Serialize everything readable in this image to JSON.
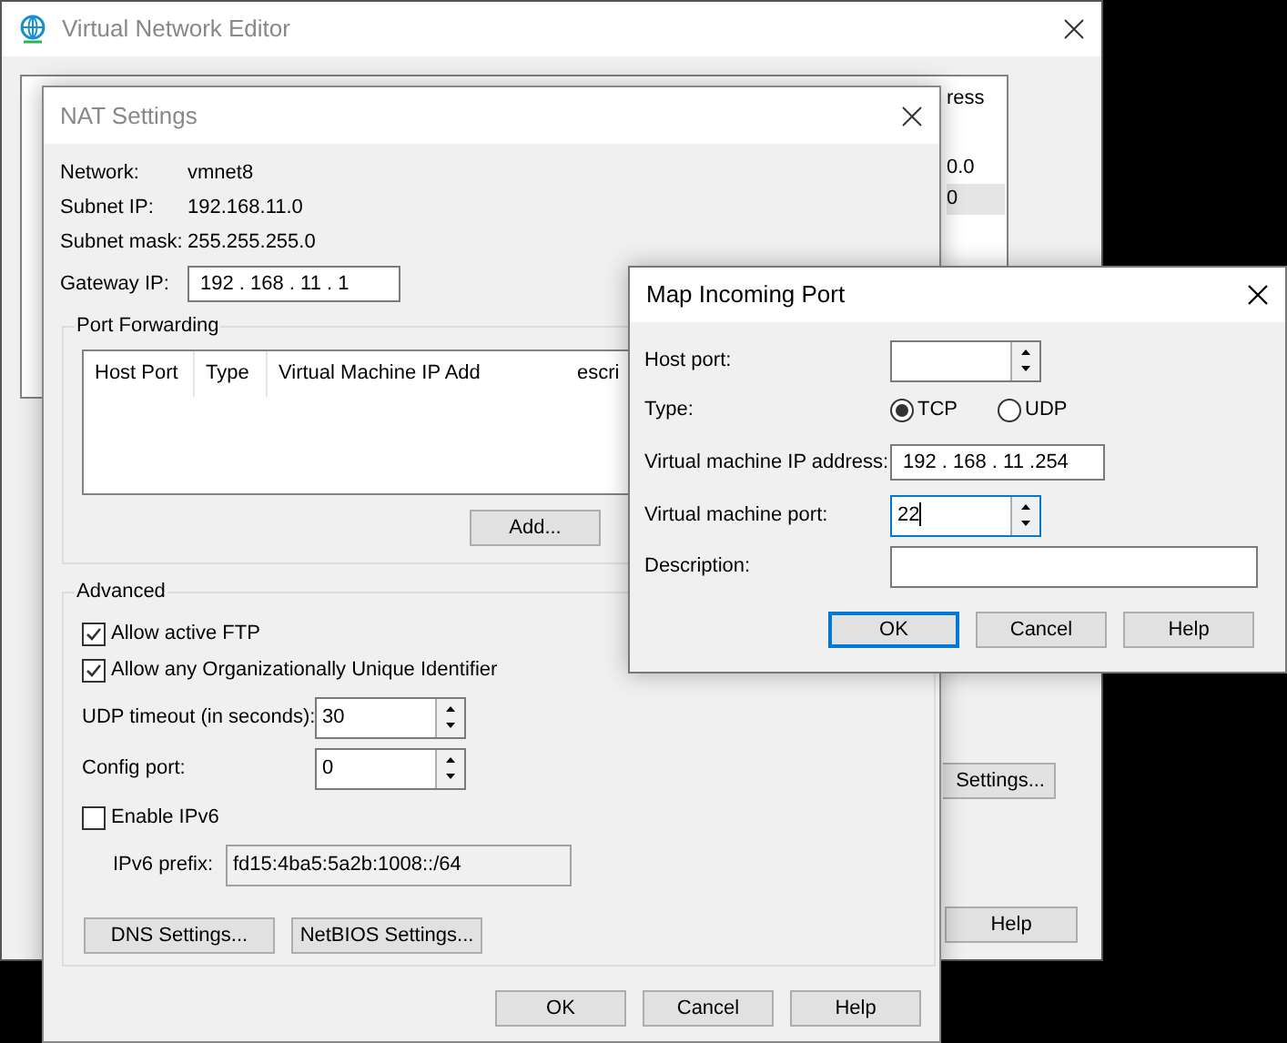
{
  "editor_window": {
    "title": "Virtual Network Editor",
    "table": {
      "header_fragment": "ress",
      "rows": [
        {
          "selected": false
        },
        {
          "column_5": "0.0",
          "selected": false
        },
        {
          "column_5": "0",
          "selected": true
        }
      ]
    },
    "buttons": [
      {
        "kind": "settings",
        "label": "Settings..."
      },
      {
        "kind": "help",
        "label": "Help"
      }
    ]
  },
  "nat_window": {
    "title": "NAT Settings",
    "info": [
      {
        "label": "Network:",
        "value": "vmnet8"
      },
      {
        "label": "Subnet IP:",
        "value": "192.168.11.0"
      },
      {
        "label": "Subnet mask:",
        "value": "255.255.255.0"
      }
    ],
    "gateway": {
      "label": "Gateway IP:",
      "value": "192 . 168 . 11 . 1"
    },
    "port_forwarding": {
      "title": "Port Forwarding",
      "columns": [
        "Host Port",
        "Type",
        "Virtual Machine IP Add",
        "escri"
      ],
      "buttons": [
        "Add..."
      ]
    },
    "advanced": {
      "title": "Advanced",
      "checkboxes": [
        {
          "label": "Allow active FTP",
          "checked": true
        },
        {
          "label": "Allow any Organizationally Unique Identifier",
          "checked": true
        }
      ],
      "spinners": [
        {
          "label": "UDP timeout (in seconds):",
          "value": "30"
        },
        {
          "label": "Config port:",
          "value": "0"
        }
      ],
      "ipv6": {
        "label": "Enable IPv6",
        "checked": false
      },
      "ipv6_prefix": {
        "label": "IPv6 prefix:",
        "value": "fd15:4ba5:5a2b:1008::/64"
      },
      "buttons": [
        "DNS Settings...",
        "NetBIOS Settings..."
      ]
    },
    "buttons": [
      "OK",
      "Cancel",
      "Help"
    ]
  },
  "map_window": {
    "title": "Map Incoming Port",
    "host_port": {
      "label": "Host port:"
    },
    "type": {
      "label": "Type:",
      "options": [
        {
          "label": "TCP",
          "selected": true
        },
        {
          "label": "UDP",
          "selected": false
        }
      ]
    },
    "vm_ip": {
      "label": "Virtual machine IP address:",
      "value": "192 . 168 . 11 .254"
    },
    "vm_port": {
      "label": "Virtual machine port:",
      "value": "22",
      "focused": true
    },
    "description": {
      "label": "Description:"
    },
    "buttons": [
      {
        "label": "OK",
        "default": true
      },
      {
        "label": "Cancel",
        "default": false
      },
      {
        "label": "Help",
        "default": false
      }
    ]
  }
}
